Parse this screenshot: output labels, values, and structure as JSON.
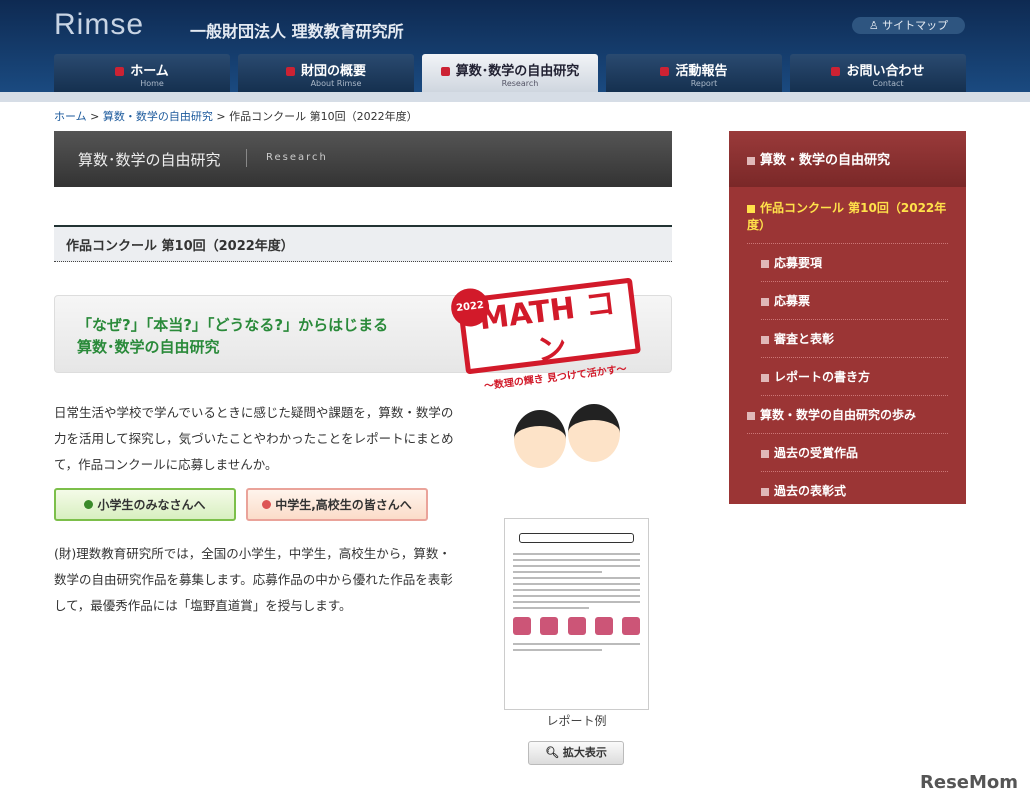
{
  "header": {
    "logo": "Rimse",
    "org": "一般財団法人 理数教育研究所",
    "sitemap": "♙ サイトマップ"
  },
  "nav": [
    {
      "jp": "ホーム",
      "en": "Home"
    },
    {
      "jp": "財団の概要",
      "en": "About Rimse"
    },
    {
      "jp": "算数･数学の自由研究",
      "en": "Research"
    },
    {
      "jp": "活動報告",
      "en": "Report"
    },
    {
      "jp": "お問い合わせ",
      "en": "Contact"
    }
  ],
  "breadcrumb": {
    "home": "ホーム",
    "sep": " > ",
    "section": "算数・数学の自由研究",
    "current": "作品コンクール 第10回（2022年度）"
  },
  "section": {
    "title": "算数･数学の自由研究",
    "en": "Research"
  },
  "page_title": "作品コンクール 第10回（2022年度）",
  "banner": {
    "line1": "「なぜ?」「本当?」「どうなる?」からはじまる",
    "line2": "算数･数学の自由研究",
    "year": "2022",
    "logo": "MATH コン",
    "slogan": "～数理の輝き 見つけて活かす～"
  },
  "intro": "日常生活や学校で学んでいるときに感じた疑問や課題を，算数・数学の力を活用して探究し，気づいたことやわかったことをレポートにまとめて，作品コンクールに応募しませんか。",
  "buttons": {
    "elementary": "小学生のみなさんへ",
    "secondary": "中学生,高校生の皆さんへ"
  },
  "para": "(財)理数教育研究所では，全国の小学生，中学生，高校生から，算数・数学の自由研究作品を募集します。応募作品の中から優れた作品を表彰して，最優秀作品には「塩野直道賞」を授与します。",
  "report": {
    "caption": "レポート例",
    "zoom": "拡大表示"
  },
  "sidebar": {
    "title": "算数・数学の自由研究",
    "current": "作品コンクール 第10回（2022年度）",
    "items": [
      "応募要項",
      "応募票",
      "審査と表彰",
      "レポートの書き方"
    ],
    "history": "算数・数学の自由研究の歩み",
    "history_items": [
      "過去の受賞作品",
      "過去の表彰式"
    ]
  },
  "watermark": "ReseMom"
}
